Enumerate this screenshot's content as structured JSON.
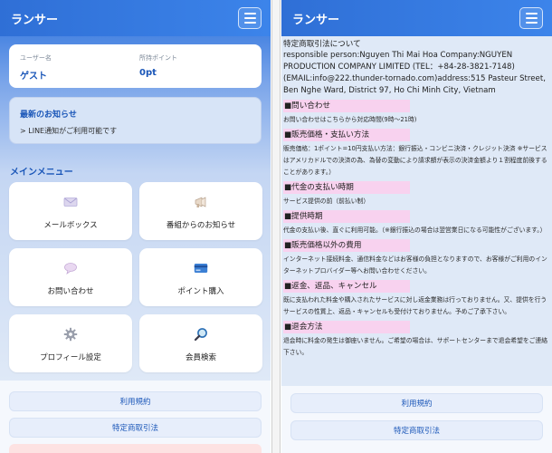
{
  "app": {
    "title": "ランサー",
    "menu_icon": "hamburger-icon"
  },
  "user": {
    "name_label": "ユーザー名",
    "name_value": "ゲスト",
    "points_label": "所持ポイント",
    "points_value": "0pt"
  },
  "news": {
    "title": "最新のお知らせ",
    "item": "> LINE通知がご利用可能です"
  },
  "main_menu": {
    "title": "メインメニュー",
    "items": [
      {
        "label": "メールボックス",
        "icon": "mailbox-icon"
      },
      {
        "label": "番組からのお知らせ",
        "icon": "megaphone-icon"
      },
      {
        "label": "お問い合わせ",
        "icon": "speech-bubble-icon"
      },
      {
        "label": "ポイント購入",
        "icon": "credit-card-icon"
      },
      {
        "label": "プロフィール設定",
        "icon": "gear-icon"
      },
      {
        "label": "会員検索",
        "icon": "magnifier-icon"
      }
    ]
  },
  "footer": {
    "terms": "利用規約",
    "commerce_law": "特定商取引法"
  },
  "doc": {
    "title": "特定商取引法について",
    "company": "responsible person:Nguyen Thi Mai Hoa Company:NGUYEN PRODUCTION COMPANY LIMITED (TEL：+84-28-3821-7148) (EMAIL:info@222.thunder-tornado.com)address:515 Pasteur Street, Ben Nghe Ward, District 97, Ho Chi Minh City, Vietnam",
    "sections": [
      {
        "heading": "■問い合わせ",
        "text": "お問い合わせはこちらから対応時間(9時〜21時)"
      },
      {
        "heading": "■販売価格・支払い方法",
        "text": "販売価格：1ポイント=10円支払い方法：銀行振込・コンビニ決済・クレジット決済 ※サービスはアメリカドルでの決済の為、為替の変動により請求額が表示の決済金額より１割程度前後することがあります。）"
      },
      {
        "heading": "■代金の支払い時期",
        "text": "サービス提供の前（前払い制）"
      },
      {
        "heading": "■提供時期",
        "text": "代金の支払い後、直ぐに利用可能。（※銀行振込の場合は翌営業日になる可能性がございます。）"
      },
      {
        "heading": "■販売価格以外の費用",
        "text": "インターネット接続料金、通信料金などはお客様の負担となりますので、お客様がご利用のインターネットプロバイダー等へお問い合わせください。"
      },
      {
        "heading": "■返金、返品、キャンセル",
        "text": "既に支払われた料金や購入されたサービスに対し返金業務は行っておりません。又、提供を行うサービスの性質上、返品・キャンセルも受付けておりません。予めご了承下さい。"
      },
      {
        "heading": "■退会方法",
        "text": "退会時に料金の発生は御座いません。ご希望の場合は、サポートセンターまで退会希望をご連絡下さい。"
      }
    ]
  },
  "colors": {
    "header_blue": "#2f6fd6",
    "accent_blue": "#1a56b8",
    "heading_pink": "#f8d2ef",
    "page_bg": "#dfe9f7"
  }
}
